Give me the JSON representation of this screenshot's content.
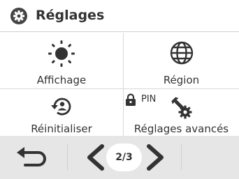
{
  "header": {
    "title": "Réglages",
    "icon": "gear-icon"
  },
  "items": {
    "affichage": {
      "label": "Affichage",
      "icon": "brightness-icon"
    },
    "region": {
      "label": "Région",
      "icon": "globe-icon"
    },
    "reinitialiser": {
      "label": "Réinitialiser",
      "icon": "reset-icon"
    },
    "avances": {
      "label": "Réglages avancés",
      "icon": "tools-icon",
      "lock_label": "PIN"
    }
  },
  "footer": {
    "page_indicator": "2/3",
    "back_icon": "back-arrow-icon",
    "prev_icon": "chevron-left-icon",
    "next_icon": "chevron-right-icon"
  },
  "colors": {
    "text": "#333333",
    "footer_bg": "#e6e6e6",
    "divider": "#d8d8d8"
  }
}
